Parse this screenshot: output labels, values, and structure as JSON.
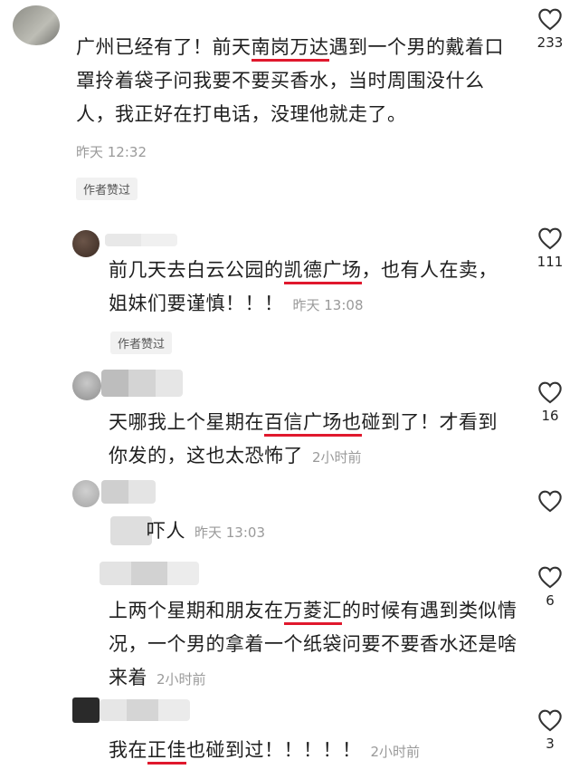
{
  "comments": [
    {
      "parts": [
        {
          "t": "广州已经有了！前天"
        },
        {
          "t": "南岗万达",
          "u": true
        },
        {
          "t": "遇到一个男的戴着口罩拎着袋子问我要不要买香水，当时周围没什么人，我正好在打电话，没理他就走了。"
        }
      ],
      "time": "昨天 12:32",
      "badge": "作者赞过",
      "likes": "233"
    },
    {
      "parts": [
        {
          "t": "前几天去白云公园的"
        },
        {
          "t": "凯德广场",
          "u": true
        },
        {
          "t": "，也有人在卖，姐妹们要谨慎！！！"
        }
      ],
      "time": "昨天 13:08",
      "badge": "作者赞过",
      "likes": "111"
    },
    {
      "parts": [
        {
          "t": "天哪我上个星期在"
        },
        {
          "t": "百信广场也",
          "u": true
        },
        {
          "t": "碰到了！才看到你发的，这也太恐怖了"
        }
      ],
      "time": "2小时前",
      "likes": "16"
    },
    {
      "parts": [
        {
          "t": "吓人"
        }
      ],
      "time": "昨天 13:03",
      "likes": ""
    },
    {
      "parts": [
        {
          "t": "上两个星期和朋友在"
        },
        {
          "t": "万菱汇",
          "u": true
        },
        {
          "t": "的时候有遇到类似情况，一个男的拿着一个纸袋问要不要香水还是啥来着"
        }
      ],
      "time": "2小时前",
      "likes": "6"
    },
    {
      "parts": [
        {
          "t": "我在"
        },
        {
          "t": "正佳",
          "u": true
        },
        {
          "t": "也碰到过！！！！！"
        }
      ],
      "time": "2小时前",
      "likes": "3"
    }
  ],
  "icons": {
    "like": "heart-outline-icon"
  },
  "colors": {
    "underline": "#e0182d",
    "meta": "#9a9a9a",
    "text": "#1f1f1f"
  }
}
